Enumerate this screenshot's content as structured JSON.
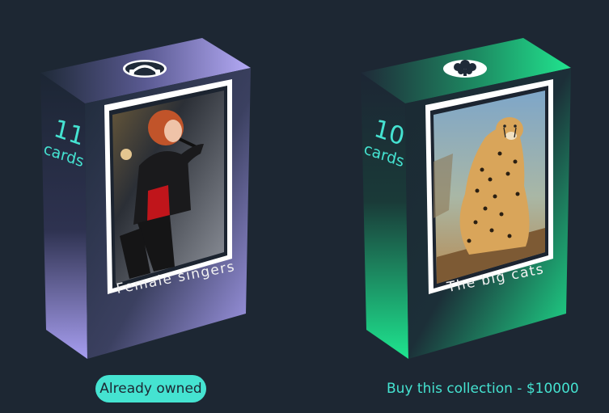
{
  "decks": [
    {
      "count": "11",
      "count_label": "cards",
      "title": "Female singers",
      "icon": "headphones-icon",
      "photo": "singer-on-stage",
      "accent": "#a79ef0",
      "status_label": "Already owned"
    },
    {
      "count": "10",
      "count_label": "cards",
      "title": "The big cats",
      "icon": "tree-icon",
      "photo": "cheetah-sitting",
      "accent": "#1ee58f",
      "buy_label": "Buy this collection - $10000"
    }
  ],
  "colors": {
    "background": "#1d2733",
    "accent_text": "#45e3d1"
  }
}
